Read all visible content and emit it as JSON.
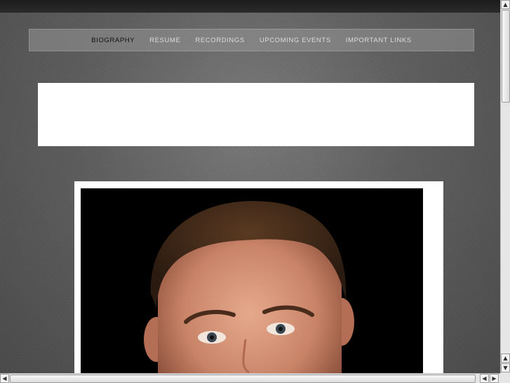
{
  "nav": {
    "items": [
      {
        "label": "BIOGRAPHY",
        "active": true
      },
      {
        "label": "RESUME",
        "active": false
      },
      {
        "label": "RECORDINGS",
        "active": false
      },
      {
        "label": "UPCOMING EVENTS",
        "active": false
      },
      {
        "label": "IMPORTANT LINKS",
        "active": false
      }
    ]
  },
  "colors": {
    "active_nav_text": "#111111",
    "nav_text": "#dcdcdc",
    "photo_background": "#000000"
  },
  "scroll": {
    "up_icon": "arrow-up-icon",
    "down_icon": "arrow-down-icon",
    "left_icon": "arrow-left-icon",
    "right_icon": "arrow-right-icon"
  }
}
